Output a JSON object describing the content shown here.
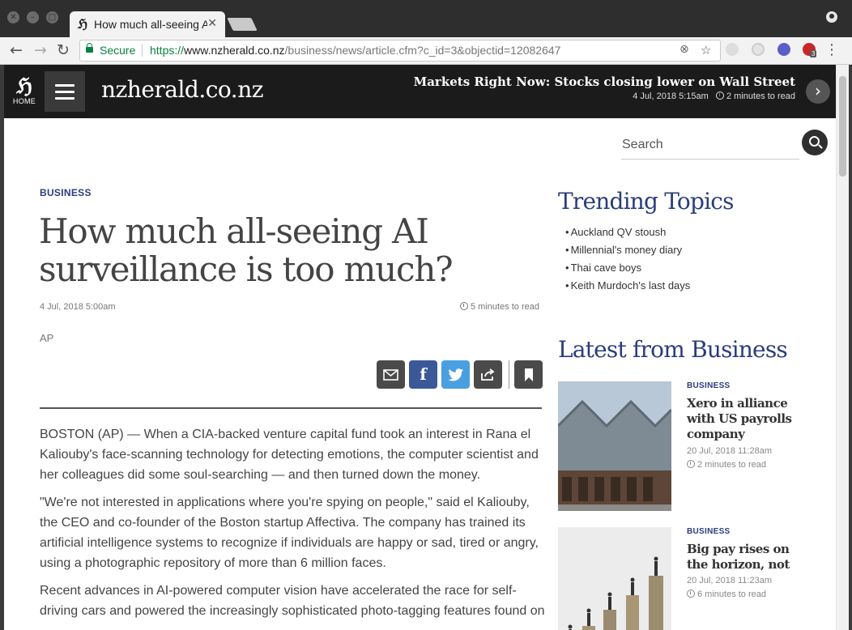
{
  "browser": {
    "tab_title": "How much all-seeing AI surveillance is too much?",
    "url_protocol": "https://",
    "url_host": "www.nzherald.co.nz",
    "url_path": "/business/news/article.cfm?c_id=3&objectid=12082647",
    "secure_label": "Secure",
    "abp_count": "3"
  },
  "header": {
    "home_label": "HOME",
    "brand": "nzherald.co.nz",
    "ticker_title": "Markets Right Now: Stocks closing lower on Wall Street",
    "ticker_date": "4 Jul, 2018 5:15am",
    "ticker_read": "2 minutes to read"
  },
  "search": {
    "placeholder": "Search"
  },
  "article": {
    "section": "BUSINESS",
    "headline": "How much all-seeing AI surveillance is too much?",
    "date": "4 Jul, 2018 5:00am",
    "read_time": "5 minutes to read",
    "byline": "AP",
    "paragraphs": [
      "BOSTON (AP) — When a CIA-backed venture capital fund took an interest in Rana el Kaliouby's face-scanning technology for detecting emotions, the computer scientist and her colleagues did some soul-searching — and then turned down the money.",
      "\"We're not interested in applications where you're spying on people,\" said el Kaliouby, the CEO and co-founder of the Boston startup Affectiva. The company has trained its artificial intelligence systems to recognize if individuals are happy or sad, tired or angry, using a photographic repository of more than 6 million faces.",
      "Recent advances in AI-powered computer vision have accelerated the race for self-driving cars and powered the increasingly sophisticated photo-tagging features found on"
    ]
  },
  "sidebar": {
    "trending_heading": "Trending Topics",
    "trending": [
      "Auckland QV stoush",
      "Millennial's money diary",
      "Thai cave boys",
      "Keith Murdoch's last days"
    ],
    "latest_heading": "Latest from Business",
    "stories": [
      {
        "section": "BUSINESS",
        "title": "Xero in alliance with US payrolls company",
        "date": "20 Jul, 2018 11:28am",
        "read": "2 minutes to read"
      },
      {
        "section": "BUSINESS",
        "title": "Big pay rises on the horizon, not",
        "date": "20 Jul, 2018 11:23am",
        "read": "6 minutes to read"
      }
    ]
  },
  "colors": {
    "brand_blue": "#2a3d7c",
    "header_bg": "#1b1b1b",
    "facebook": "#3b5998",
    "twitter": "#4a9fe0"
  }
}
